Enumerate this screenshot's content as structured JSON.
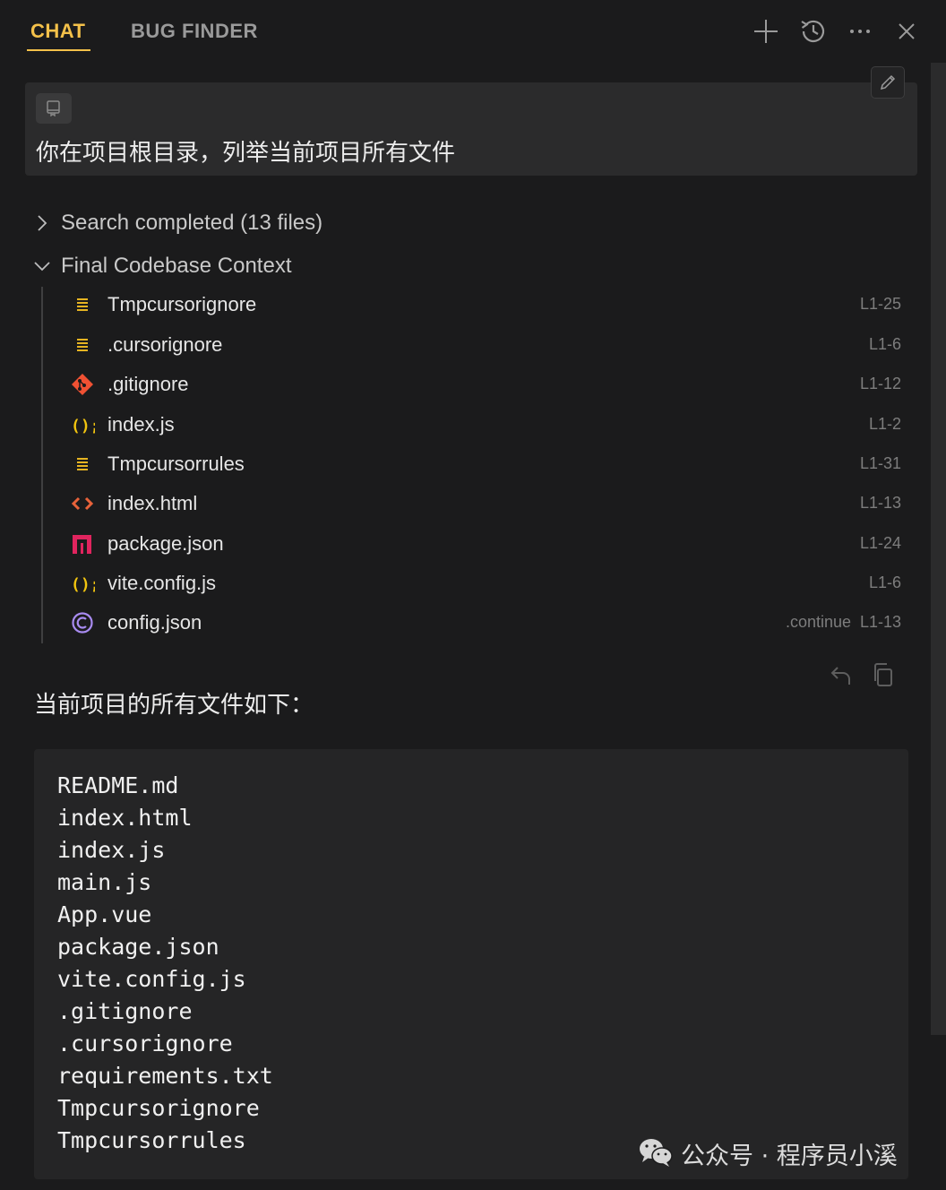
{
  "header": {
    "tabs": [
      {
        "label": "CHAT",
        "active": true
      },
      {
        "label": "BUG FINDER",
        "active": false
      }
    ],
    "icons": [
      "plus-icon",
      "history-icon",
      "more-icon",
      "close-icon"
    ],
    "accent_color": "#f4c14a"
  },
  "prompt": {
    "text": "你在项目根目录，列举当前项目所有文件",
    "context_icon": "repo-icon",
    "edit_icon": "pencil-icon"
  },
  "search_section": {
    "label": "Search completed (13 files)",
    "expanded": false
  },
  "context_section": {
    "label": "Final Codebase Context",
    "expanded": true,
    "files": [
      {
        "name": "Tmpcursorignore",
        "range": "L1-25",
        "icon": "text-file-icon"
      },
      {
        "name": ".cursorignore",
        "range": "L1-6",
        "icon": "text-file-icon"
      },
      {
        "name": ".gitignore",
        "range": "L1-12",
        "icon": "git-icon"
      },
      {
        "name": "index.js",
        "range": "L1-2",
        "icon": "js-icon"
      },
      {
        "name": "Tmpcursorrules",
        "range": "L1-31",
        "icon": "text-file-icon"
      },
      {
        "name": "index.html",
        "range": "L1-13",
        "icon": "html-icon"
      },
      {
        "name": "package.json",
        "range": "L1-24",
        "icon": "npm-icon"
      },
      {
        "name": "vite.config.js",
        "range": "L1-6",
        "icon": "js-icon"
      },
      {
        "name": "config.json",
        "range": "L1-13",
        "prefix": ".continue",
        "icon": "continue-icon"
      }
    ]
  },
  "message_actions": [
    "undo-icon",
    "copy-icon"
  ],
  "answer": {
    "intro": "当前项目的所有文件如下：",
    "code_lines": [
      "README.md",
      "index.html",
      "index.js",
      "main.js",
      "App.vue",
      "package.json",
      "vite.config.js",
      ".gitignore",
      ".cursorignore",
      "requirements.txt",
      "Tmpcursorignore",
      "Tmpcursorrules"
    ]
  },
  "watermark": {
    "text": "公众号 · 程序员小溪",
    "icon": "wechat-icon"
  }
}
